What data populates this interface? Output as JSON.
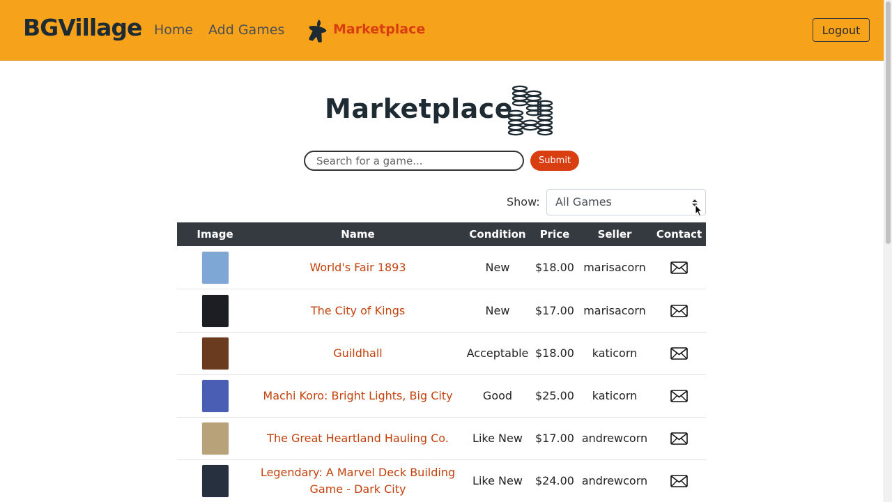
{
  "nav": {
    "brand": "BGVillage",
    "home": "Home",
    "add_games": "Add Games",
    "marketplace": "Marketplace",
    "logout": "Logout"
  },
  "header": {
    "title": "Marketplace"
  },
  "search": {
    "placeholder": "Search for a game...",
    "submit": "Submit"
  },
  "filter": {
    "label": "Show:",
    "selected": "All Games"
  },
  "table": {
    "headers": [
      "Image",
      "Name",
      "Condition",
      "Price",
      "Seller",
      "Contact"
    ],
    "rows": [
      {
        "name": "World's Fair 1893",
        "condition": "New",
        "price": "$18.00",
        "seller": "marisacorn",
        "thumb_color": "#7fa7d6"
      },
      {
        "name": "The City of Kings",
        "condition": "New",
        "price": "$17.00",
        "seller": "marisacorn",
        "thumb_color": "#1d1d24"
      },
      {
        "name": "Guildhall",
        "condition": "Acceptable",
        "price": "$18.00",
        "seller": "katicorn",
        "thumb_color": "#6b3b1f"
      },
      {
        "name": "Machi Koro: Bright Lights, Big City",
        "condition": "Good",
        "price": "$25.00",
        "seller": "katicorn",
        "thumb_color": "#4a5fb3"
      },
      {
        "name": "The Great Heartland Hauling Co.",
        "condition": "Like New",
        "price": "$17.00",
        "seller": "andrewcorn",
        "thumb_color": "#b7a27a"
      },
      {
        "name": "Legendary: A Marvel Deck Building Game - Dark City",
        "condition": "Like New",
        "price": "$24.00",
        "seller": "andrewcorn",
        "thumb_color": "#27303f"
      }
    ]
  },
  "colors": {
    "navbar": "#f7a21b",
    "accent": "#d83e0f",
    "link": "#c2410c",
    "table_header": "#343a40"
  }
}
